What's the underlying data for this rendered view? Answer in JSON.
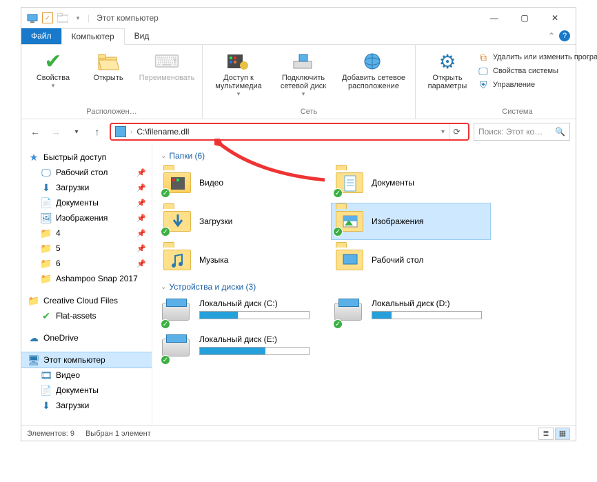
{
  "window": {
    "title": "Этот компьютер"
  },
  "tabs": {
    "file": "Файл",
    "computer": "Компьютер",
    "view": "Вид"
  },
  "ribbon": {
    "location": {
      "label": "Расположен…",
      "properties": "Свойства",
      "open": "Открыть",
      "rename": "Переименовать"
    },
    "network": {
      "label": "Сеть",
      "media": "Доступ к мультимедиа",
      "map_drive": "Подключить сетевой диск",
      "add_location": "Добавить сетевое расположение"
    },
    "system": {
      "label": "Система",
      "settings": "Открыть параметры",
      "uninstall": "Удалить или изменить программу",
      "sysprops": "Свойства системы",
      "manage": "Управление"
    }
  },
  "address_bar": {
    "path": "C:\\filename.dll"
  },
  "search": {
    "placeholder": "Поиск: Этот ко…"
  },
  "tree": {
    "quick_access": "Быстрый доступ",
    "desktop": "Рабочий стол",
    "downloads": "Загрузки",
    "documents": "Документы",
    "pictures": "Изображения",
    "four": "4",
    "five": "5",
    "six": "6",
    "ashampoo": "Ashampoo Snap 2017",
    "creative_cloud": "Creative Cloud Files",
    "flat_assets": "Flat-assets",
    "onedrive": "OneDrive",
    "this_pc": "Этот компьютер",
    "videos": "Видео",
    "documents2": "Документы",
    "downloads2": "Загрузки"
  },
  "content": {
    "folders_header": "Папки (6)",
    "devices_header": "Устройства и диски (3)",
    "folders": {
      "videos": "Видео",
      "documents": "Документы",
      "downloads": "Загрузки",
      "pictures": "Изображения",
      "music": "Музыка",
      "desktop": "Рабочий стол"
    },
    "drives": {
      "c": {
        "label": "Локальный диск (C:)",
        "fill": 35
      },
      "d": {
        "label": "Локальный диск (D:)",
        "fill": 18
      },
      "e": {
        "label": "Локальный диск (E:)",
        "fill": 60
      }
    }
  },
  "status": {
    "items": "Элементов: 9",
    "selected": "Выбран 1 элемент"
  }
}
